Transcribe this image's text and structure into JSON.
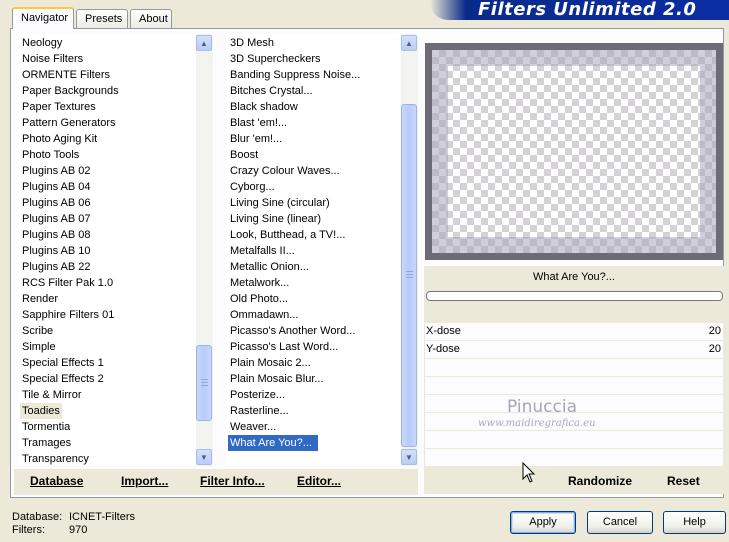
{
  "tabs": [
    {
      "label": "Navigator",
      "active": true
    },
    {
      "label": "Presets",
      "active": false
    },
    {
      "label": "About",
      "active": false
    }
  ],
  "banner": {
    "title": "Filters Unlimited 2.0"
  },
  "categories": {
    "items": [
      "Neology",
      "Noise Filters",
      "ORMENTE Filters",
      "Paper Backgrounds",
      "Paper Textures",
      "Pattern Generators",
      "Photo Aging Kit",
      "Photo Tools",
      "Plugins AB 02",
      "Plugins AB 04",
      "Plugins AB 06",
      "Plugins AB 07",
      "Plugins AB 08",
      "Plugins AB 10",
      "Plugins AB 22",
      "RCS Filter Pak 1.0",
      "Render",
      "Sapphire Filters 01",
      "Scribe",
      "Simple",
      "Special Effects 1",
      "Special Effects 2",
      "Tile & Mirror",
      "Toadies",
      "Tormentia",
      "Tramages",
      "Transparency"
    ],
    "selected": "Toadies"
  },
  "filters": {
    "items": [
      "3D Mesh",
      "3D Supercheckers",
      "Banding Suppress Noise...",
      "Bitches Crystal...",
      "Black shadow",
      "Blast 'em!...",
      "Blur 'em!...",
      "Boost",
      "Crazy Colour Waves...",
      "Cyborg...",
      "Living Sine (circular)",
      "Living Sine (linear)",
      "Look, Butthead, a TV!...",
      "Metalfalls II...",
      "Metallic Onion...",
      "Metalwork...",
      "Old Photo...",
      "Ommadawn...",
      "Picasso's Another Word...",
      "Picasso's Last Word...",
      "Plain Mosaic 2...",
      "Plain Mosaic Blur...",
      "Posterize...",
      "Rasterline...",
      "Weaver...",
      "What Are You?..."
    ],
    "selected": "What Are You?..."
  },
  "preview": {
    "filter_name": "What Are You?..."
  },
  "params": [
    {
      "label": "X-dose",
      "value": "20"
    },
    {
      "label": "Y-dose",
      "value": "20"
    }
  ],
  "actions": {
    "database": "Database",
    "import": "Import...",
    "filter_info": "Filter Info...",
    "editor": "Editor...",
    "randomize": "Randomize",
    "reset": "Reset"
  },
  "watermark": {
    "name": "Pinuccia",
    "url": "www.maidiregrafica.eu"
  },
  "footer": {
    "database_label": "Database:",
    "database_value": "ICNET-Filters",
    "filters_label": "Filters:",
    "filters_value": "970"
  },
  "dialog": {
    "apply": "Apply",
    "cancel": "Cancel",
    "help": "Help"
  },
  "colors": {
    "selection": "#316ac5",
    "banner": "#0b2da3",
    "background": "#ece9d8"
  }
}
